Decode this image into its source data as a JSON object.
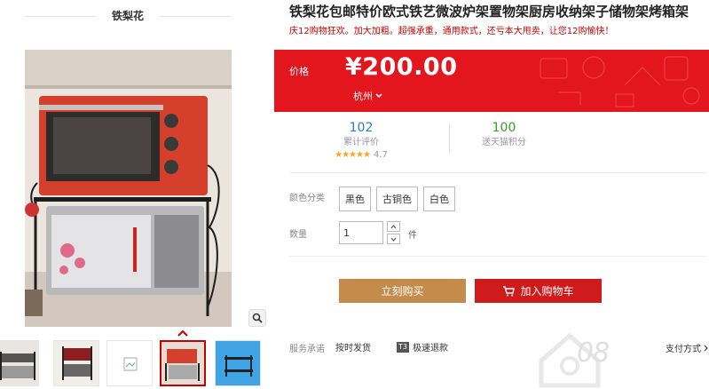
{
  "gallery": {
    "shop_name": "铁梨花",
    "thumbnail_count": 5,
    "active_thumbnail": 4
  },
  "product": {
    "title": "铁梨花包邮特价欧式铁艺微波炉架置物架厨房收纳架子储物架烤箱架",
    "subtitle": "庆12购物狂欢。加大加粗。超强承重，通用款式，还亏本大甩卖，让您12购愉快！"
  },
  "price": {
    "label": "价格",
    "value": "¥200.00",
    "location": "杭州"
  },
  "stats": {
    "reviews_count": "102",
    "reviews_label": "累计评价",
    "rating": "4.7",
    "points_value": "100",
    "points_label": "送天猫积分"
  },
  "options": {
    "color_label": "颜色分类",
    "colors": [
      "黑色",
      "古铜色",
      "白色"
    ],
    "quantity_label": "数量",
    "quantity_value": "1",
    "quantity_unit": "件"
  },
  "actions": {
    "buy_now": "立刻购买",
    "add_to_cart": "加入购物车"
  },
  "services": {
    "label": "服务承诺",
    "items": [
      "按时发货",
      "极速退款"
    ],
    "badge": "T3",
    "payment_label": "支付方式"
  },
  "watermark": {
    "text": "08"
  },
  "colors": {
    "price_red": "#e3151d",
    "buy_button": "#c58b4a",
    "cart_button": "#cf1b1b",
    "accent_red": "#c40000",
    "review_blue": "#2b7ec4",
    "points_green": "#3b9b2e",
    "star_orange": "#f5a623"
  },
  "icons": [
    "zoom-icon",
    "chevron-up-icon",
    "chevron-down-icon",
    "cart-icon",
    "star-icon",
    "watermark-house-icon"
  ]
}
